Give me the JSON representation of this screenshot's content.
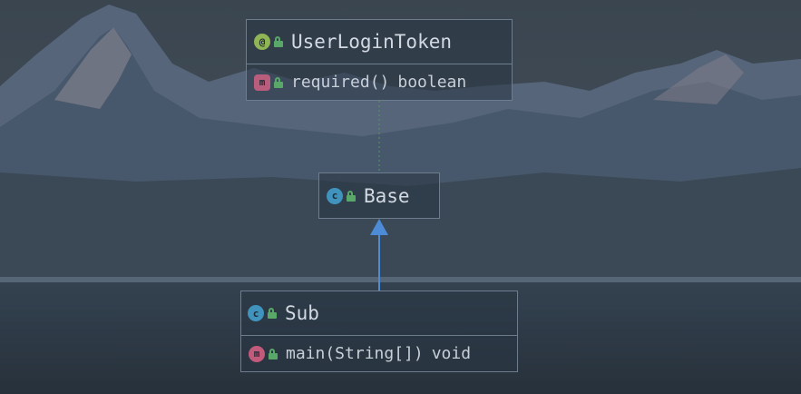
{
  "diagram": {
    "nodes": [
      {
        "id": "userlogintoken",
        "name": "UserLoginToken",
        "kind_icon": "annotation-icon",
        "kind_glyph": "@",
        "kind_color": "#8fb554",
        "members": [
          {
            "signature": "required()",
            "type": "boolean",
            "kind_icon": "method-abstract-icon",
            "kind_glyph": "m",
            "kind_color": "#b85d7b"
          }
        ]
      },
      {
        "id": "base",
        "name": "Base",
        "kind_icon": "class-icon",
        "kind_glyph": "c",
        "kind_color": "#3f93bd",
        "members": []
      },
      {
        "id": "sub",
        "name": "Sub",
        "kind_icon": "runnable-class-icon",
        "kind_glyph": "c",
        "kind_color": "#3f93bd",
        "members": [
          {
            "signature": "main(String[])",
            "type": "void",
            "kind_icon": "static-method-icon",
            "kind_glyph": "m",
            "kind_color": "#c25a7c"
          }
        ]
      }
    ],
    "edges": [
      {
        "from": "sub",
        "to": "base",
        "relation": "extends",
        "style": "solid",
        "color": "#4d8bd6"
      },
      {
        "from": "base",
        "to": "userlogintoken",
        "relation": "annotated-by",
        "style": "dotted",
        "color": "#4f9a5b"
      }
    ]
  },
  "colors": {
    "sky": "#3e4a55",
    "mountain": "#4b5a6a",
    "water": "#2c3642",
    "node_border": "#6d7d8e",
    "text": "#d2d9e2",
    "visibility": "#59a869"
  }
}
